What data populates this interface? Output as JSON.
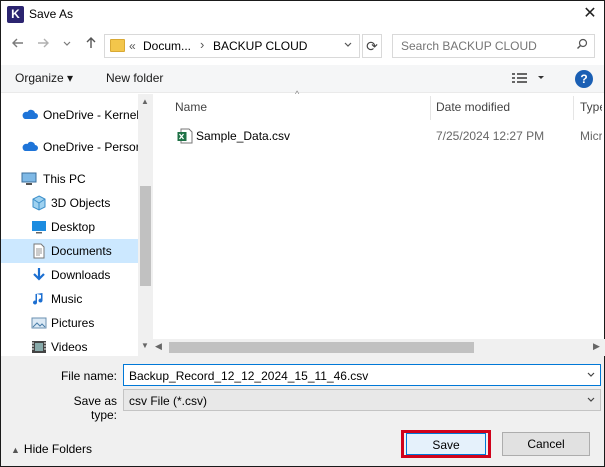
{
  "window": {
    "title": "Save As",
    "app_icon_letter": "K",
    "close_glyph": "✕"
  },
  "nav": {
    "back_icon": "arrow-left-icon",
    "forward_icon": "arrow-right-icon",
    "recent_icon": "chevron-down-icon",
    "up_icon": "arrow-up-icon",
    "breadcrumb": {
      "overflow": "«",
      "parent": "Docum...",
      "separator": "›",
      "current": "BACKUP CLOUD"
    },
    "search_placeholder": "Search BACKUP CLOUD"
  },
  "toolbar": {
    "organize": "Organize ▾",
    "new_folder": "New folder"
  },
  "sidebar": {
    "items": [
      {
        "label": "OneDrive - Kernel",
        "icon": "cloud-icon"
      },
      {
        "label": "OneDrive - Persor",
        "icon": "cloud-icon"
      },
      {
        "label": "This PC",
        "icon": "computer-icon"
      },
      {
        "label": "3D Objects",
        "icon": "cube-icon"
      },
      {
        "label": "Desktop",
        "icon": "desktop-icon"
      },
      {
        "label": "Documents",
        "icon": "document-icon",
        "selected": true
      },
      {
        "label": "Downloads",
        "icon": "download-icon"
      },
      {
        "label": "Music",
        "icon": "music-icon"
      },
      {
        "label": "Pictures",
        "icon": "pictures-icon"
      },
      {
        "label": "Videos",
        "icon": "video-icon"
      }
    ]
  },
  "files": {
    "columns": {
      "name": "Name",
      "date": "Date modified",
      "type": "Type"
    },
    "rows": [
      {
        "name": "Sample_Data.csv",
        "date": "7/25/2024 12:27 PM",
        "type": "Micr",
        "icon": "excel-icon"
      }
    ]
  },
  "form": {
    "file_name_label": "File name:",
    "file_name_value": "Backup_Record_12_12_2024_15_11_46.csv",
    "save_type_label": "Save as type:",
    "save_type_value": "csv File (*.csv)"
  },
  "footer": {
    "hide_folders": "Hide Folders",
    "save": "Save",
    "cancel": "Cancel"
  },
  "colors": {
    "accent": "#0078d7",
    "highlight_border": "#d0021b",
    "selected_bg": "#cce8ff"
  }
}
